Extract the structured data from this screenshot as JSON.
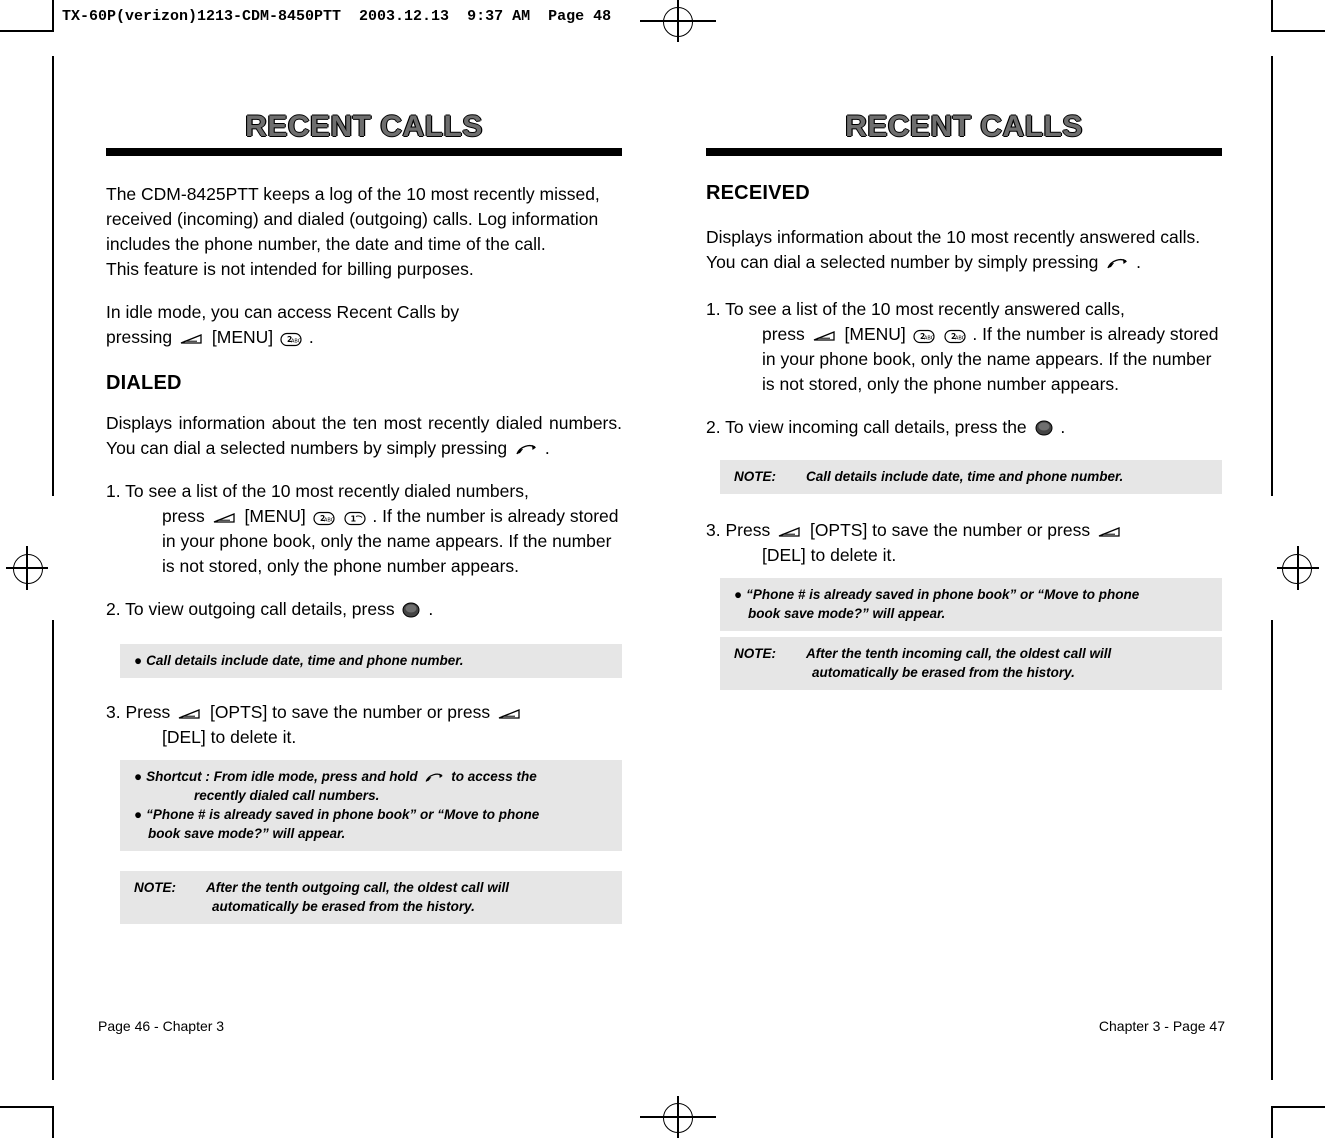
{
  "printer_header": "TX-60P(verizon)1213-CDM-8450PTT  2003.12.13  9:37 AM  Page 48",
  "left_page": {
    "title": "RECENT CALLS",
    "intro": "The CDM-8425PTT keeps a log of the 10 most recently missed, received (incoming) and dialed (outgoing) calls. Log information includes the phone number, the date and time of the call.",
    "intro2": "This feature is not intended for billing purposes.",
    "idle_line1": "In idle mode, you can access Recent Calls by",
    "idle_line2_a": "pressing",
    "idle_line2_b": "[MENU]",
    "idle_line2_c": ".",
    "subhead": "DIALED",
    "dialed_desc_a": "Displays information about the ten most recently dialed numbers. You can dial a selected numbers by simply pressing",
    "dialed_desc_b": ".",
    "step1_a": "1. To see a list of the 10 most recently dialed numbers,",
    "step1_b": "press",
    "step1_c": "[MENU]",
    "step1_d": ". If the number is already stored in your phone book, only the name appears. If the number is not stored, only the phone number appears.",
    "step2_a": "2. To view outgoing call details, press",
    "step2_b": ".",
    "note_call_details": "Call details include date, time and phone number.",
    "step3_a": "3. Press",
    "step3_b": "[OPTS] to save the number or press",
    "step3_c": "[DEL] to delete it.",
    "shortcut_a": "Shortcut : From idle mode, press and hold",
    "shortcut_b": "to access the",
    "shortcut_c": "recently dialed call numbers.",
    "phonebook_note_a": "“Phone # is already saved in phone book” or “Move to phone",
    "phonebook_note_b": "book save mode?” will appear.",
    "note_label": "NOTE:",
    "note_tenth_a": "After the tenth outgoing call, the oldest call will",
    "note_tenth_b": "automatically be erased from the history.",
    "footer": "Page 46 - Chapter 3"
  },
  "right_page": {
    "title": "RECENT CALLS",
    "subhead": "RECEIVED",
    "received_desc_a": "Displays information about the 10 most recently answered calls. You can dial a selected number by simply pressing",
    "received_desc_b": ".",
    "step1_a": "1. To see a list of the 10 most recently answered calls,",
    "step1_b": "press",
    "step1_c": "[MENU]",
    "step1_d": ". If the number is already stored in your phone book, only the name appears. If the number is not stored, only the phone number appears.",
    "step2_a": "2. To view incoming call details, press the",
    "step2_b": ".",
    "note_label": "NOTE:",
    "note_call_details": "Call details include date, time and phone number.",
    "step3_a": "3. Press",
    "step3_b": "[OPTS] to save the number or press",
    "step3_c": "[DEL] to delete it.",
    "phonebook_note_a": "“Phone # is already saved in phone book” or “Move to phone",
    "phonebook_note_b": "book save mode?” will appear.",
    "note_tenth_a": "After the tenth incoming call, the oldest call will",
    "note_tenth_b": "automatically be erased from the history.",
    "footer": "Chapter 3 - Page 47"
  },
  "icons": {
    "soft_key": "soft-key-icon",
    "send_key": "send-key-icon",
    "nav_key": "navigation-key-icon",
    "key_2abc": "key-2abc-icon",
    "key_1": "key-1-icon"
  }
}
